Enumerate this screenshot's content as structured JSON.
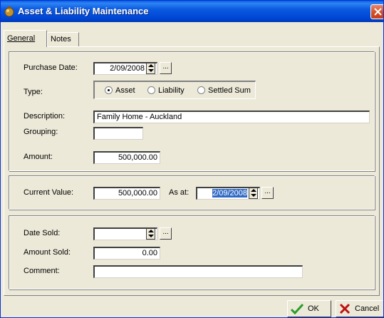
{
  "window": {
    "title": "Asset & Liability Maintenance"
  },
  "tabs": [
    {
      "label": "General",
      "active": true
    },
    {
      "label": "Notes",
      "active": false
    }
  ],
  "general": {
    "purchase_date": {
      "label": "Purchase Date:",
      "value": "2/09/2008"
    },
    "type": {
      "label": "Type:",
      "options": [
        {
          "label": "Asset",
          "selected": true
        },
        {
          "label": "Liability",
          "selected": false
        },
        {
          "label": "Settled Sum",
          "selected": false
        }
      ]
    },
    "description": {
      "label": "Description:",
      "value": "Family Home - Auckland"
    },
    "grouping": {
      "label": "Grouping:",
      "value": ""
    },
    "amount": {
      "label": "Amount:",
      "value": "500,000.00"
    }
  },
  "current": {
    "current_value": {
      "label": "Current Value:",
      "value": "500,000.00"
    },
    "as_at": {
      "label": "As at:",
      "value": "2/09/2008"
    }
  },
  "sold": {
    "date_sold": {
      "label": "Date Sold:",
      "value": ""
    },
    "amount_sold": {
      "label": "Amount Sold:",
      "value": "0.00"
    },
    "comment": {
      "label": "Comment:",
      "value": ""
    }
  },
  "buttons": {
    "ok": "OK",
    "cancel": "Cancel"
  },
  "ellipsis": "...",
  "colors": {
    "titlebar": "#0b5ae0",
    "window_bg": "#ece9d8",
    "selection": "#316ac5",
    "close": "#d34a22",
    "ok_check": "#2a9d2a",
    "cancel_x": "#c01010"
  }
}
